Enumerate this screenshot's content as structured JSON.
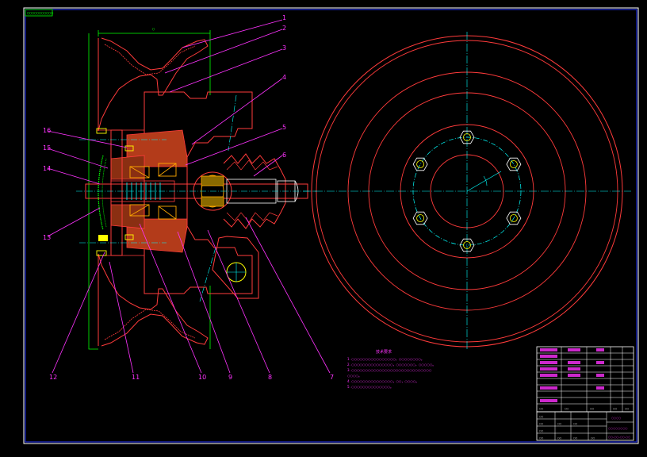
{
  "stamp": "○○○○○○○○○○○",
  "dimension_top": "○",
  "callouts": {
    "c1": "1",
    "c2": "2",
    "c3": "3",
    "c4": "4",
    "c5": "5",
    "c6": "6",
    "c7": "7",
    "c8": "8",
    "c9": "9",
    "c10": "10",
    "c11": "11",
    "c12": "12",
    "c13": "13",
    "c14": "14",
    "c15": "15",
    "c16": "16"
  },
  "notes": {
    "title": "技术要求",
    "lines": [
      "1. ○○○○○○○○○○○○○○○○，○○○○○○○○。",
      "2. ○○○○○○○○○○○○○○○，○○○○○○○，○○○○○。",
      "3. ○○○○○○○○○○○○○○○○○○○○○○○○○○○○○",
      "   ○○○○。",
      "4. ○○○○○○○○○○○○○○○，○○，○○○○。",
      "5. ○○○○○○○○○○○○○○。"
    ]
  },
  "title_block": {
    "drawing_name": "○○○○",
    "part_name": "○○○○○○○○",
    "drawing_number": "○○-○○-○○-○○",
    "cells": [
      "○○",
      "○○",
      "○○",
      "○○",
      "○○",
      "○○",
      "○○",
      "○○",
      "○○",
      "○○",
      "○○",
      "○○",
      "○○",
      "○○"
    ]
  }
}
